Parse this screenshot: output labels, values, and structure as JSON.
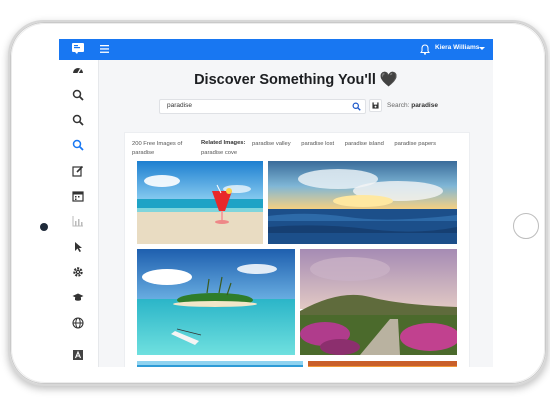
{
  "header": {
    "user_name": "Kiera Williams"
  },
  "sidebar": {
    "items": [
      {
        "icon": "dashboard-icon"
      },
      {
        "icon": "search-icon"
      },
      {
        "icon": "search-icon"
      },
      {
        "icon": "search-icon",
        "active": true
      },
      {
        "icon": "edit-icon"
      },
      {
        "icon": "calendar-icon"
      },
      {
        "icon": "bar-chart-icon"
      },
      {
        "icon": "cursor-icon"
      },
      {
        "icon": "gear-icon"
      },
      {
        "icon": "graduation-cap-icon"
      },
      {
        "icon": "globe-icon"
      },
      {
        "icon": "font-icon"
      }
    ]
  },
  "main": {
    "headline": "Discover Something You'll 🖤",
    "search": {
      "value": "paradise"
    },
    "search_label_prefix": "Search:",
    "search_label_value": "paradise",
    "results": {
      "count_text": "200 Free Images of paradise",
      "related_label": "Related Images:",
      "related_tags": [
        "paradise valley",
        "paradise lost",
        "paradise island",
        "paradise papers",
        "paradise cove"
      ]
    }
  },
  "colors": {
    "brand": "#1877f2",
    "background": "#f5f6f8"
  }
}
